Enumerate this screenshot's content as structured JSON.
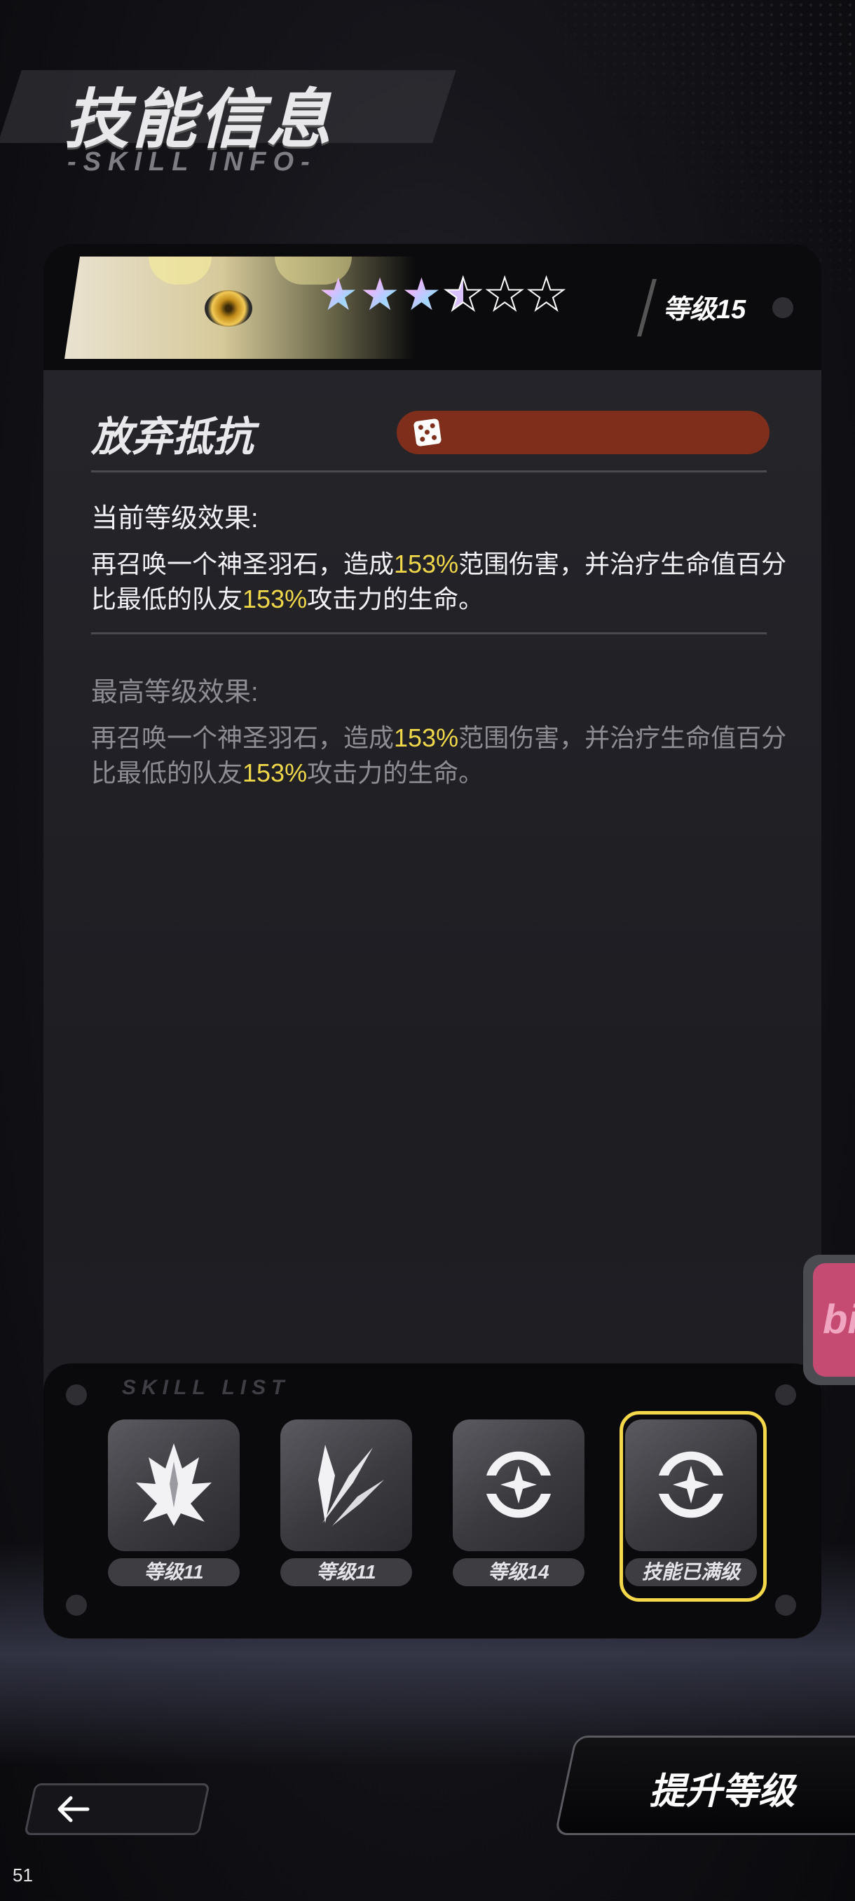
{
  "header": {
    "title": "技能信息",
    "subtitle": "-SKILL INFO-"
  },
  "skill_card": {
    "stars": {
      "filled": 3.5,
      "total": 6
    },
    "level_label": "等级15",
    "skill_name": "放弃抵抗",
    "current_effect": {
      "label": "当前等级效果:",
      "text_before_1": "再召唤一个神圣羽石，造成",
      "value_1": "153%",
      "text_mid": "范围伤害，并治疗生命值百分比最低的队友",
      "value_2": "153%",
      "text_after": "攻击力的生命。"
    },
    "max_effect": {
      "label": "最高等级效果:",
      "text_before_1": "再召唤一个神圣羽石，造成",
      "value_1": "153%",
      "text_mid": "范围伤害，并治疗生命值百分比最低的队友",
      "value_2": "153%",
      "text_after": "攻击力的生命。"
    }
  },
  "skill_list": {
    "title": "SKILL LIST",
    "items": [
      {
        "icon": "crown-icon",
        "level": "等级11",
        "selected": false
      },
      {
        "icon": "claw-icon",
        "level": "等级11",
        "selected": false
      },
      {
        "icon": "orbit-star-icon",
        "level": "等级14",
        "selected": false
      },
      {
        "icon": "orbit-star-icon",
        "level": "技能已满级",
        "selected": true
      }
    ]
  },
  "controls": {
    "back_icon": "arrow-left-icon",
    "upgrade_label": "提升等级",
    "side_tab_text": "bi"
  },
  "page_number": "51",
  "colors": {
    "highlight": "#f0d84a",
    "selected_border": "#f5d84a",
    "tag_bar": "#7f2e1b",
    "side_tab": "#c64b72"
  }
}
